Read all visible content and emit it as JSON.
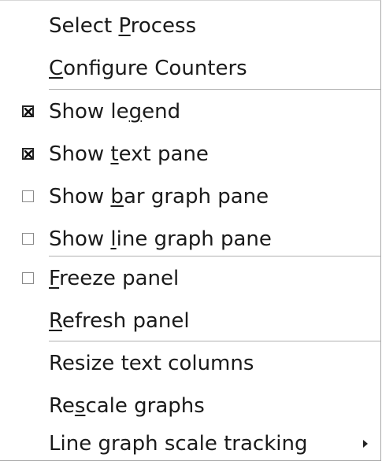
{
  "menu": {
    "items": [
      {
        "pre": "Select ",
        "mn": "P",
        "post": "rocess",
        "check": null,
        "submenu": false
      },
      {
        "pre": "",
        "mn": "C",
        "post": "onfigure Counters",
        "check": null,
        "submenu": false
      },
      {
        "pre": "Show le",
        "mn": "g",
        "post": "end",
        "check": true,
        "submenu": false
      },
      {
        "pre": "Show ",
        "mn": "t",
        "post": "ext pane",
        "check": true,
        "submenu": false
      },
      {
        "pre": "Show ",
        "mn": "b",
        "post": "ar graph pane",
        "check": false,
        "submenu": false
      },
      {
        "pre": "Show ",
        "mn": "l",
        "post": "ine graph pane",
        "check": false,
        "submenu": false
      },
      {
        "pre": "",
        "mn": "F",
        "post": "reeze panel",
        "check": false,
        "submenu": false
      },
      {
        "pre": "",
        "mn": "R",
        "post": "efresh panel",
        "check": null,
        "submenu": false
      },
      {
        "pre": "Resize text columns",
        "mn": "",
        "post": "",
        "check": null,
        "submenu": false
      },
      {
        "pre": "Re",
        "mn": "s",
        "post": "cale graphs",
        "check": null,
        "submenu": false
      },
      {
        "pre": "Line graph scale tracking",
        "mn": "",
        "post": "",
        "check": null,
        "submenu": true
      }
    ]
  }
}
